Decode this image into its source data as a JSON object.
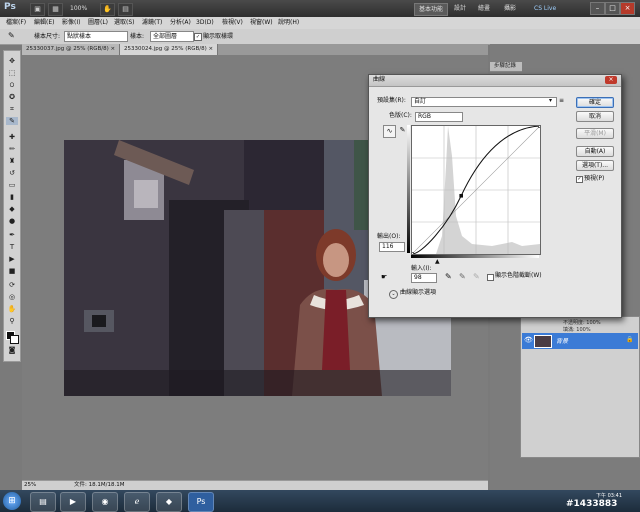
{
  "titlebar": {
    "logo": "Ps",
    "zoom": "100%",
    "workspace_active": "基本功能",
    "workspace_items": [
      "設計",
      "繪畫",
      "攝影"
    ],
    "cslive": "CS Live"
  },
  "menu": [
    "檔案(F)",
    "編輯(E)",
    "影像(I)",
    "圖層(L)",
    "選取(S)",
    "濾鏡(T)",
    "分析(A)",
    "3D(D)",
    "檢視(V)",
    "視窗(W)",
    "說明(H)"
  ],
  "options": {
    "sample_size_label": "樣本尺寸:",
    "sample_size_value": "點狀樣本",
    "sample_label": "樣本:",
    "sample_value": "全部圖層",
    "show_ring": "顯示取樣環"
  },
  "tabs": [
    {
      "label": "25330037.jpg @ 25% (RGB/8)",
      "close": "×"
    },
    {
      "label": "25330024.jpg @ 25% (RGB/8)",
      "close": "×"
    }
  ],
  "status": {
    "zoom": "25%",
    "doc": "文件: 18.1M/18.1M"
  },
  "panels": {
    "history_tab": "步驟記錄",
    "layers_opacity": "不透明度: 100%",
    "layers_fill": "填滿: 100%",
    "layer_name": "背景"
  },
  "curves": {
    "title": "曲線",
    "preset_label": "預設集(R):",
    "preset_value": "自訂",
    "channel_label": "色版(C):",
    "channel_value": "RGB",
    "output_label": "輸出(O):",
    "output_value": "116",
    "input_label": "輸入(I):",
    "input_value": "98",
    "show_clipping": "顯示色階截斷(W)",
    "curve_display": "曲線顯示選項",
    "buttons": {
      "ok": "確定",
      "cancel": "取消",
      "smooth": "平滑(M)",
      "auto": "自動(A)",
      "options": "選項(T)...",
      "preview": "預視(P)"
    },
    "curve_points": [
      [
        0,
        0
      ],
      [
        98,
        116
      ],
      [
        255,
        255
      ]
    ]
  },
  "taskbar": {
    "time": "下午 03:41",
    "watermark": "#1433883"
  },
  "colors": {
    "accent": "#3b7bd6",
    "title_dark": "#2e2e2e",
    "dialog_bg": "#e6e6e6"
  }
}
